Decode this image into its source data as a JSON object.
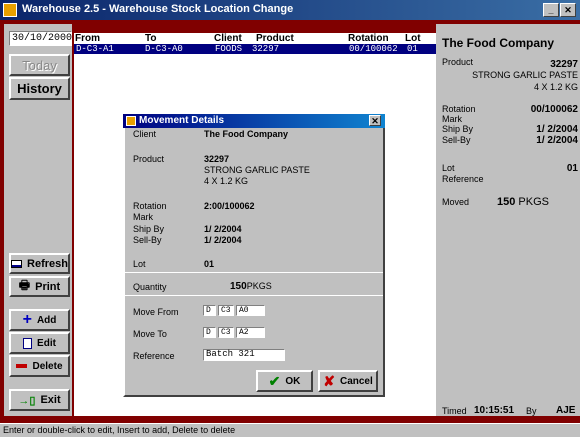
{
  "window": {
    "title": "Warehouse 2.5 - Warehouse Stock Location Change"
  },
  "left": {
    "date": "30/10/2000",
    "today": "Today",
    "history": "History",
    "refresh": "Refresh",
    "print": "Print",
    "add": "Add",
    "edit": "Edit",
    "delete": "Delete",
    "exit": "Exit"
  },
  "grid": {
    "headers": {
      "from": "From",
      "to": "To",
      "client": "Client",
      "product": "Product",
      "rotation": "Rotation",
      "lot": "Lot"
    },
    "rows": [
      {
        "from": "D-C3-A1",
        "to": "D-C3-A0",
        "client": "FOODS",
        "product": "32297",
        "rotation": "00/100062",
        "lot": "01"
      }
    ]
  },
  "right": {
    "company": "The Food Company",
    "product_label": "Product",
    "product_code": "32297",
    "product_name": "STRONG GARLIC PASTE",
    "product_pack": "4 X 1.2 KG",
    "rotation_label": "Rotation",
    "rotation_value": "00/100062",
    "mark_label": "Mark",
    "shipby_label": "Ship By",
    "shipby_value": "1/ 2/2004",
    "sellby_label": "Sell-By",
    "sellby_value": "1/ 2/2004",
    "lot_label": "Lot",
    "lot_value": "01",
    "reference_label": "Reference",
    "moved_label": "Moved",
    "moved_qty": "150",
    "moved_unit": "PKGS",
    "timed_label": "Timed",
    "timed_value": "10:15:51",
    "by_label": "By",
    "by_value": "AJE"
  },
  "dialog": {
    "title": "Movement Details",
    "client_label": "Client",
    "client_value": "The Food Company",
    "product_label": "Product",
    "product_code": "32297",
    "product_name": "STRONG GARLIC PASTE",
    "product_pack": "4 X 1.2 KG",
    "rotation_label": "Rotation",
    "rotation_value": "2:00/100062",
    "mark_label": "Mark",
    "shipby_label": "Ship By",
    "shipby_value": "1/ 2/2004",
    "sellby_label": "Sell-By",
    "sellby_value": "1/ 2/2004",
    "lot_label": "Lot",
    "lot_value": "01",
    "quantity_label": "Quantity",
    "quantity_value": "150",
    "quantity_unit": "PKGS",
    "movefrom_label": "Move From",
    "movefrom": [
      "D",
      "C3",
      "A0"
    ],
    "moveto_label": "Move To",
    "moveto": [
      "D",
      "C3",
      "A2"
    ],
    "reference_label": "Reference",
    "reference_value": "Batch 321",
    "ok": "OK",
    "cancel": "Cancel"
  },
  "status": "Enter or double-click to edit, Insert to add, Delete to delete",
  "colors": {
    "desktop": "#800000",
    "titlebar": "#0a246a",
    "selection": "#000080",
    "face": "#c0c0c0"
  }
}
